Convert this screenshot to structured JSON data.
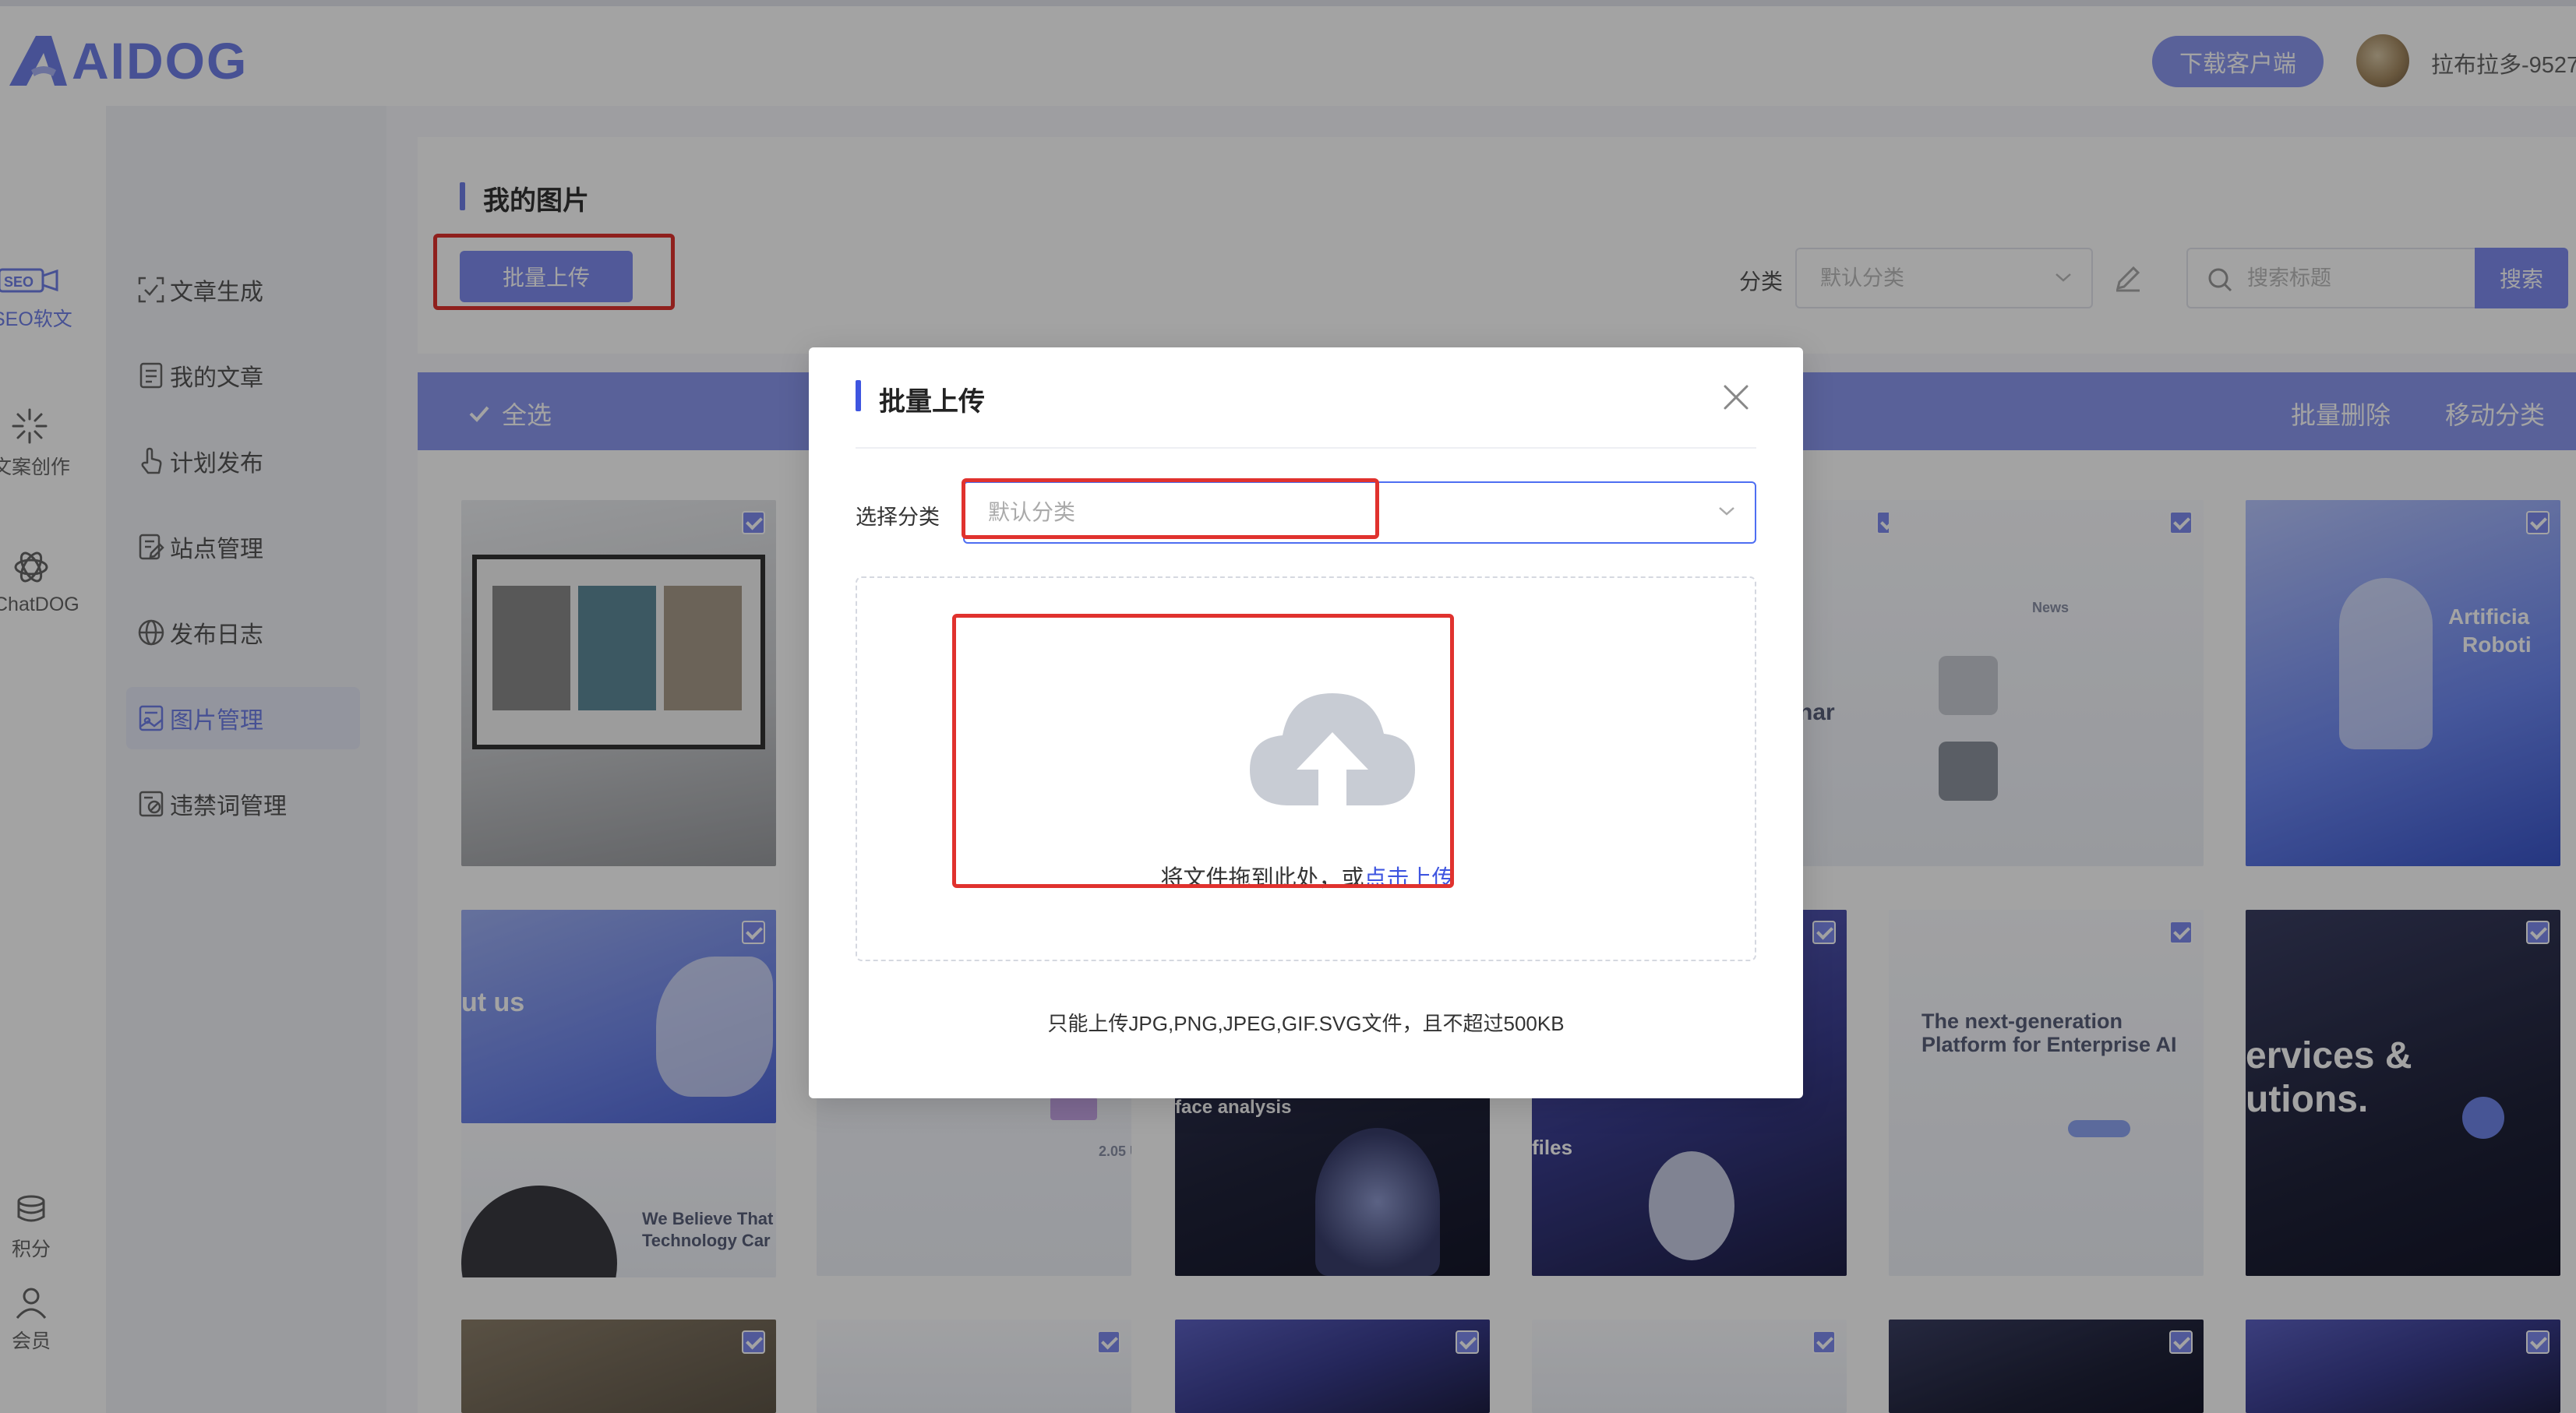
{
  "header": {
    "logo": "AIDOG",
    "download_label": "下载客户端",
    "username": "拉布拉多-9527"
  },
  "rail": {
    "items": [
      {
        "label": "SEO软文",
        "icon": "seo-icon"
      },
      {
        "label": "文案创作",
        "icon": "sparkle-icon"
      },
      {
        "label": "ChatDOG",
        "icon": "chat-icon"
      }
    ],
    "bottom": [
      {
        "label": "积分",
        "icon": "coins-icon"
      },
      {
        "label": "会员",
        "icon": "user-icon"
      }
    ]
  },
  "sidebar": {
    "items": [
      {
        "label": "文章生成",
        "icon": "scan-icon"
      },
      {
        "label": "我的文章",
        "icon": "document-icon"
      },
      {
        "label": "计划发布",
        "icon": "hand-icon"
      },
      {
        "label": "站点管理",
        "icon": "edit-doc-icon"
      },
      {
        "label": "发布日志",
        "icon": "globe-icon"
      },
      {
        "label": "图片管理",
        "icon": "image-icon",
        "active": true
      },
      {
        "label": "违禁词管理",
        "icon": "forbidden-icon"
      }
    ]
  },
  "main": {
    "title": "我的图片",
    "batch_upload_label": "批量上传",
    "category_label": "分类",
    "category_placeholder": "默认分类",
    "search_placeholder": "搜索标题",
    "search_label": "搜索",
    "select_all_label": "全选",
    "bulk_delete_label": "批量删除",
    "move_category_label": "移动分类"
  },
  "thumbs": {
    "t1": "",
    "t2": "nar",
    "t3": "News",
    "t4": "Artificia",
    "t4b": "Roboti",
    "t5": "ut us",
    "t6": "The next-generation",
    "t6b": "Platform for Enterprise AI",
    "t7": "ervices &",
    "t7b": "utions.",
    "t8": "We Believe That",
    "t8b": "Technology Car",
    "t9": "face analysis",
    "t10": "files",
    "t11": "2.05 U"
  },
  "modal": {
    "title": "批量上传",
    "select_label": "选择分类",
    "select_placeholder": "默认分类",
    "drop_text": "将文件拖到此处，或",
    "drop_link": "点击上传",
    "hint": "只能上传JPG,PNG,JPEG,GIF.SVG文件，且不超过500KB"
  },
  "colors": {
    "accent": "#7f8cf0",
    "modal_accent": "#3e55e0",
    "highlight": "#e0322e"
  }
}
